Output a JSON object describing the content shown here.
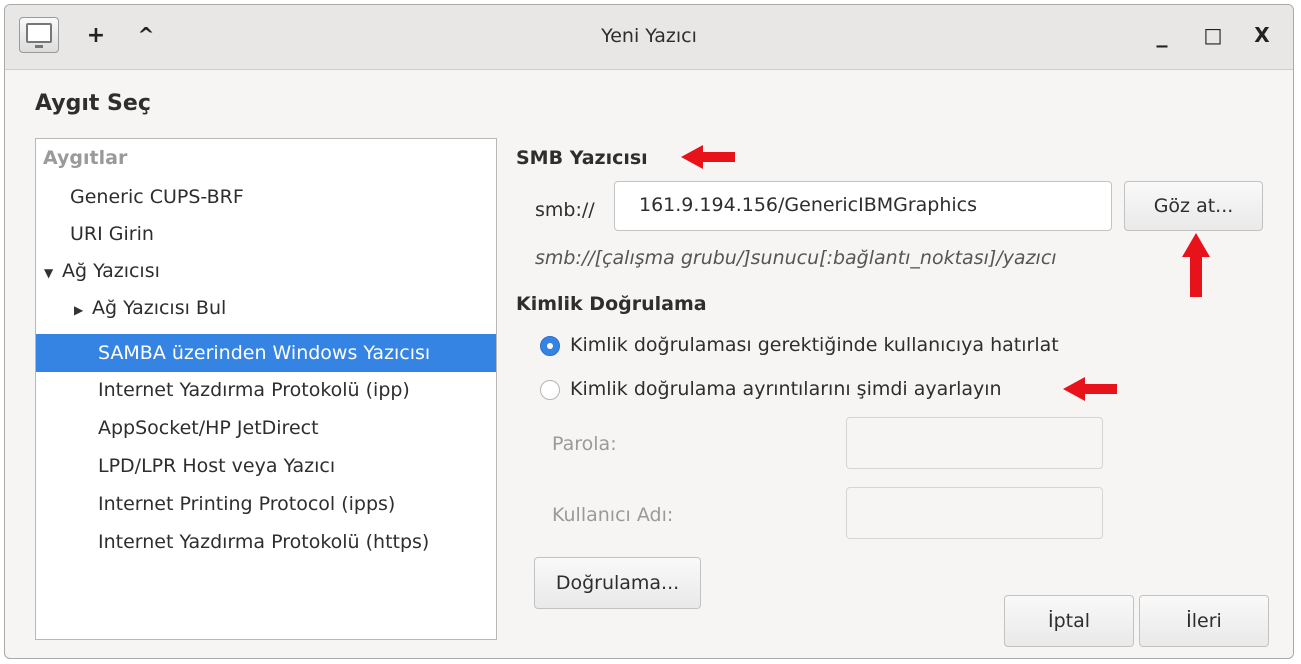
{
  "window": {
    "title": "Yeni Yazıcı",
    "titlebar_buttons": {
      "pin": "+",
      "shade": "^",
      "minimize": "_",
      "maximize": "□",
      "close": "X"
    }
  },
  "dialog": {
    "heading": "Aygıt Seç"
  },
  "devices": {
    "header": "Aygıtlar",
    "items": [
      {
        "label": "Generic CUPS-BRF"
      },
      {
        "label": "URI Girin"
      },
      {
        "label": "Ağ Yazıcısı",
        "expander": "▼"
      },
      {
        "label": "Ağ Yazıcısı Bul",
        "expander": "▶"
      },
      {
        "label": "SAMBA üzerinden Windows Yazıcısı",
        "selected": true
      },
      {
        "label": "Internet Yazdırma Protokolü (ipp)"
      },
      {
        "label": "AppSocket/HP JetDirect"
      },
      {
        "label": "LPD/LPR Host veya Yazıcı"
      },
      {
        "label": "Internet Printing Protocol (ipps)"
      },
      {
        "label": "Internet Yazdırma Protokolü (https)"
      }
    ]
  },
  "smb": {
    "section_title": "SMB Yazıcısı",
    "prefix": "smb://",
    "uri_value": "161.9.194.156/GenericIBMGraphics",
    "browse_button": "Göz at...",
    "format_hint": "smb://[çalışma grubu/]sunucu[:bağlantı_noktası]/yazıcı"
  },
  "auth": {
    "section_title": "Kimlik Doğrulama",
    "option_prompt": "Kimlik doğrulaması gerektiğinde kullanıcıya hatırlat",
    "option_now": "Kimlik doğrulama ayrıntılarını şimdi ayarlayın",
    "password_label": "Parola:",
    "username_label": "Kullanıcı Adı:",
    "verify_button": "Doğrulama..."
  },
  "footer": {
    "cancel_button": "İptal",
    "next_button": "İleri"
  },
  "colors": {
    "selection": "#3584e4",
    "annotation_arrow": "#e8131a"
  }
}
